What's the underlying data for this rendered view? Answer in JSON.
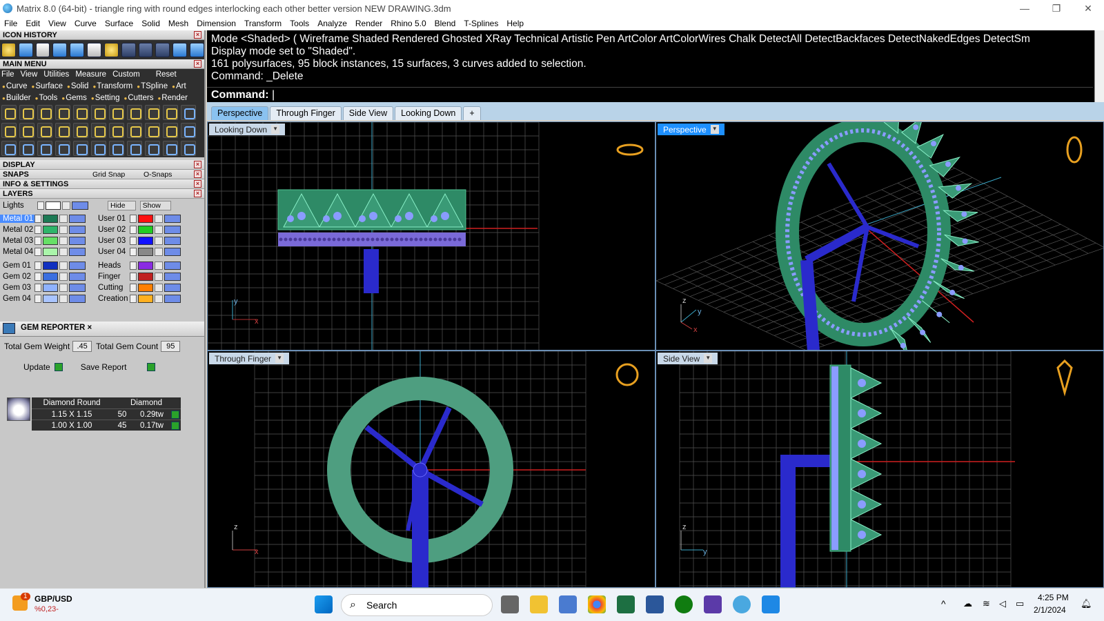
{
  "window": {
    "title": "Matrix 8.0 (64-bit) - triangle ring with round edges interlocking each other better version NEW DRAWING.3dm",
    "controls": [
      "—",
      "❐",
      "✕"
    ]
  },
  "menubar": [
    "File",
    "Edit",
    "View",
    "Curve",
    "Surface",
    "Solid",
    "Mesh",
    "Dimension",
    "Transform",
    "Tools",
    "Analyze",
    "Render",
    "Rhino 5.0",
    "Blend",
    "T-Splines",
    "Help"
  ],
  "panel": {
    "icon_history": "ICON HISTORY",
    "main_menu": "MAIN MENU",
    "main_menu_items": [
      "File",
      "View",
      "Utilities",
      "Measure",
      "Custom"
    ],
    "reset": "Reset",
    "categories_row1": [
      "Curve",
      "Surface",
      "Solid",
      "Transform",
      "TSpline",
      "Art"
    ],
    "categories_row2": [
      "Builder",
      "Tools",
      "Gems",
      "Setting",
      "Cutters",
      "Render"
    ],
    "display": "DISPLAY",
    "snaps": "SNAPS",
    "grid_snap": "Grid Snap",
    "osnaps": "O-Snaps",
    "info": "INFO & SETTINGS",
    "layers": "LAYERS",
    "lights": "Lights",
    "hide": "Hide",
    "show": "Show",
    "layers_left": [
      {
        "name": "Metal 01",
        "color": "#1d7a55",
        "selected": true
      },
      {
        "name": "Metal 02",
        "color": "#2fb56a"
      },
      {
        "name": "Metal 03",
        "color": "#66e066"
      },
      {
        "name": "Metal 04",
        "color": "#aaf5aa"
      },
      {
        "name": "Gem 01",
        "color": "#1030c0"
      },
      {
        "name": "Gem 02",
        "color": "#3b6fe0"
      },
      {
        "name": "Gem 03",
        "color": "#8fb2ff"
      },
      {
        "name": "Gem 04",
        "color": "#a9c4ff"
      }
    ],
    "layers_right": [
      {
        "name": "User 01",
        "color": "#ff1010"
      },
      {
        "name": "User 02",
        "color": "#22cc22"
      },
      {
        "name": "User 03",
        "color": "#1010ff"
      },
      {
        "name": "User 04",
        "color": "#888888"
      },
      {
        "name": "Heads",
        "color": "#8a2be2"
      },
      {
        "name": "Finger",
        "color": "#c02020"
      },
      {
        "name": "Cutting",
        "color": "#ff7f00"
      },
      {
        "name": "Creation",
        "color": "#ffb020"
      }
    ]
  },
  "gem_reporter": {
    "title": "GEM REPORTER",
    "weight_label": "Total Gem Weight",
    "weight_value": ".45",
    "count_label": "Total Gem Count",
    "count_value": "95",
    "update": "Update",
    "save_report": "Save Report",
    "table_headers": [
      "Diamond Round",
      "Diamond"
    ],
    "rows": [
      {
        "size": "1.15 X 1.15",
        "count": "50",
        "weight": "0.29tw"
      },
      {
        "size": "1.00 X 1.00",
        "count": "45",
        "weight": "0.17tw"
      }
    ]
  },
  "command": {
    "lines": [
      "Mode <Shaded> ( Wireframe  Shaded  Rendered  Ghosted  XRay  Technical  Artistic  Pen  ArtColor  ArtColorWires  Chalk  DetectAll  DetectBackfaces  DetectNakedEdges  DetectSm",
      "Display mode set to \"Shaded\".",
      "161 polysurfaces, 95 block instances, 15 surfaces, 3 curves added to selection.",
      "Command: _Delete"
    ],
    "prompt": "Command:"
  },
  "tabs": [
    "Perspective",
    "Through Finger",
    "Side View",
    "Looking Down",
    "+"
  ],
  "viewports": {
    "tl": "Looking Down",
    "tr": "Perspective",
    "bl": "Through Finger",
    "br": "Side View"
  },
  "axes": {
    "tl": [
      "y",
      "x"
    ],
    "tr": [
      "z",
      "y",
      "x"
    ],
    "bl": [
      "z",
      "x"
    ],
    "br": [
      "z",
      "y"
    ]
  },
  "taskbar": {
    "widget_badge": "1",
    "widget_title": "GBP/USD",
    "widget_value": "%0,23-",
    "search": "Search",
    "time": "4:25 PM",
    "date": "2/1/2024"
  },
  "colors": {
    "metal": "#2e8a66",
    "gem": "#8a9cff",
    "shank": "#1a1acc",
    "grid": "#5a5a5a"
  }
}
